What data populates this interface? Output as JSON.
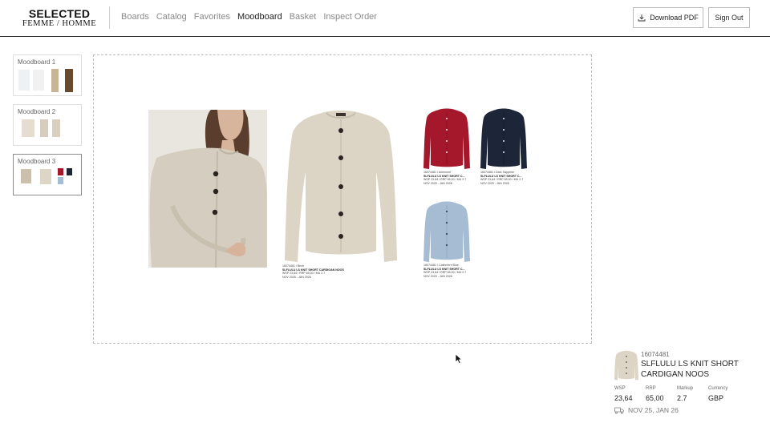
{
  "brand": {
    "name": "SELECTED",
    "sub": "FEMME / HOMME"
  },
  "nav": [
    {
      "label": "Boards",
      "active": false
    },
    {
      "label": "Catalog",
      "active": false
    },
    {
      "label": "Favorites",
      "active": false
    },
    {
      "label": "Moodboard",
      "active": true
    },
    {
      "label": "Basket",
      "active": false
    },
    {
      "label": "Inspect Order",
      "active": false
    }
  ],
  "actions": {
    "download_label": "Download PDF",
    "signout_label": "Sign Out"
  },
  "moodboards": [
    {
      "label": "Moodboard 1",
      "active": false
    },
    {
      "label": "Moodboard 2",
      "active": false
    },
    {
      "label": "Moodboard 3",
      "active": true
    }
  ],
  "canvas": {
    "items": [
      {
        "meta1": "16074481 / Birch",
        "name": "SLFLULU LS KNIT SHORT CARDIGAN NOOS",
        "prices": "WSP 23,64 / RRP 65,00 / MU 2.7",
        "dates": "NOV 2025 - JAN 2026",
        "color": "#dcd4c5"
      },
      {
        "meta1": "16074481 / Anemone",
        "name": "SLFLULU LS KNIT SHORT C...",
        "prices": "WSP 23,64 / RRP 65,00 / MU 2.7",
        "dates": "NOV 2025 - JAN 2026",
        "color": "#a5172b"
      },
      {
        "meta1": "16074481 / Dark Sapphire",
        "name": "SLFLULU LS KNIT SHORT C...",
        "prices": "WSP 23,64 / RRP 65,00 / MU 2.7",
        "dates": "NOV 2025 - JAN 2026",
        "color": "#1d2638"
      },
      {
        "meta1": "16074481 / Cashmere Blue",
        "name": "SLFLULU LS KNIT SHORT C...",
        "prices": "WSP 23,64 / RRP 65,00 / MU 2.7",
        "dates": "NOV 2025 - JAN 2026",
        "color": "#a6bcd3"
      }
    ]
  },
  "detail": {
    "id": "16074481",
    "name": "SLFLULU LS KNIT SHORT CARDIGAN NOOS",
    "wsp_label": "WSP",
    "wsp": "23,64",
    "rrp_label": "RRP",
    "rrp": "65,00",
    "markup_label": "Markup",
    "markup": "2.7",
    "currency_label": "Currency",
    "currency": "GBP",
    "delivery": "NOV 25, JAN 26"
  },
  "icons": {
    "download": "download-icon",
    "truck": "truck-icon",
    "cursor": "mouse-pointer-icon"
  }
}
